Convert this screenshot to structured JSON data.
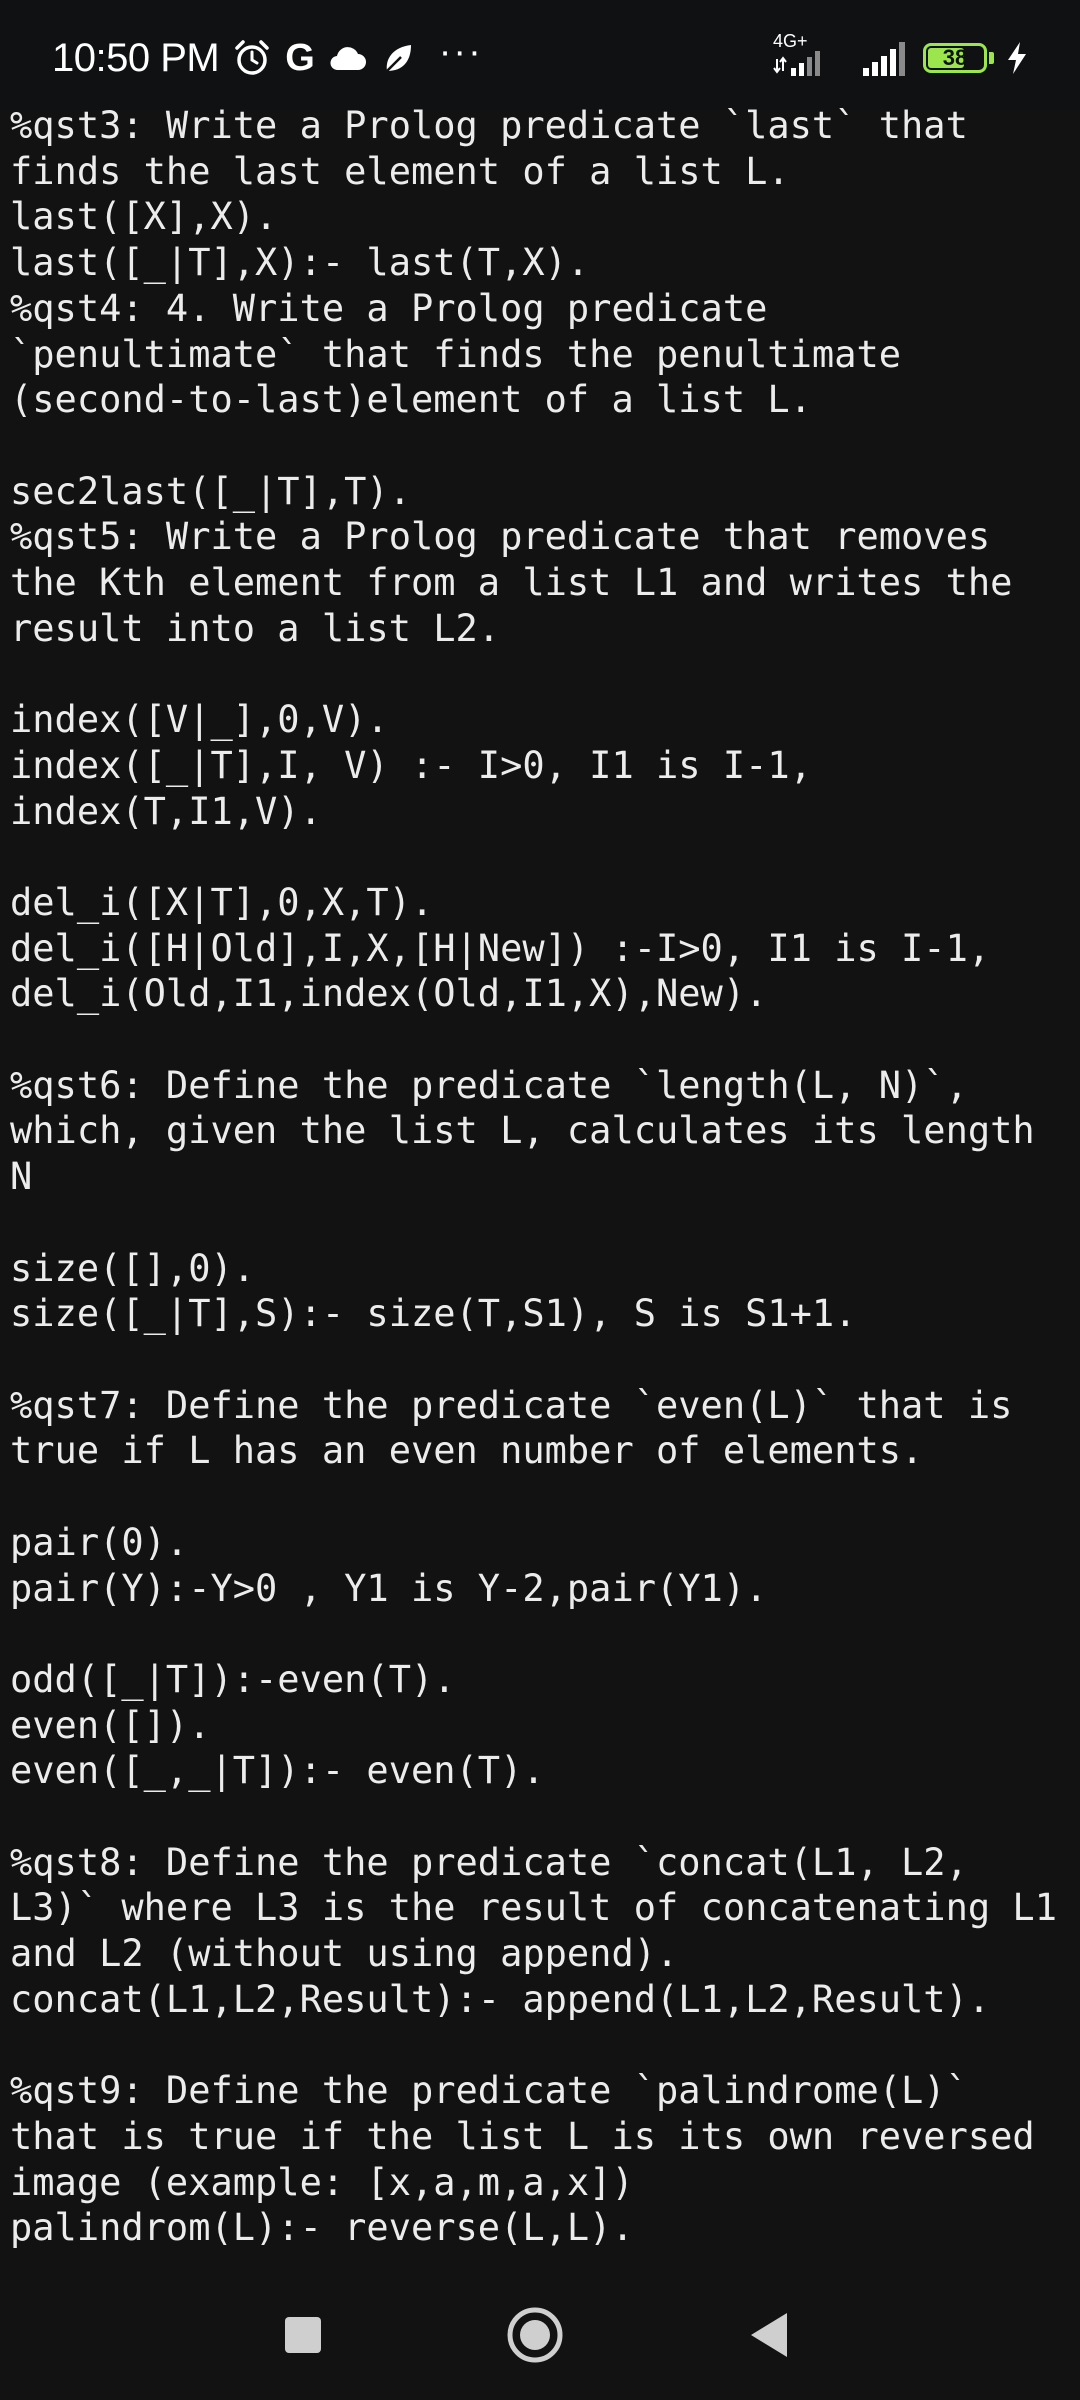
{
  "status_bar": {
    "time": "10:50 PM",
    "icons_left": [
      "alarm-icon",
      "google-icon",
      "cloud-icon",
      "app-notification-icon"
    ],
    "google_letter": "G",
    "overflow": "···",
    "network_label": "4G+",
    "battery_level": "38",
    "battery_fraction": 0.38,
    "battery_color": "#9be64d",
    "charging": true
  },
  "document": {
    "text": "%qst3: Write a Prolog predicate `last` that finds the last element of a list L.\nlast([X],X).\nlast([_|T],X):- last(T,X).\n%qst4: 4. Write a Prolog predicate `penultimate` that finds the penultimate (second-to-last)element of a list L.\n\nsec2last([_|T],T).\n%qst5: Write a Prolog predicate that removes the Kth element from a list L1 and writes the result into a list L2.\n\nindex([V|_],0,V).\nindex([_|T],I, V) :- I>0, I1 is I-1, index(T,I1,V).\n\ndel_i([X|T],0,X,T).\ndel_i([H|Old],I,X,[H|New]) :-I>0, I1 is I-1, del_i(Old,I1,index(Old,I1,X),New).\n\n%qst6: Define the predicate `length(L, N)`, which, given the list L, calculates its length N\n\nsize([],0).\nsize([_|T],S):- size(T,S1), S is S1+1.\n\n%qst7: Define the predicate `even(L)` that is true if L has an even number of elements.\n\npair(0).\npair(Y):-Y>0 , Y1 is Y-2,pair(Y1).\n\nodd([_|T]):-even(T).\neven([]).\neven([_,_|T]):- even(T).\n\n%qst8: Define the predicate `concat(L1, L2, L3)` where L3 is the result of concatenating L1 and L2 (without using append).\nconcat(L1,L2,Result):- append(L1,L2,Result).\n\n%qst9: Define the predicate `palindrome(L)` that is true if the list L is its own reversed image (example: [x,a,m,a,x])\npalindrom(L):- reverse(L,L)."
  },
  "nav_bar": {
    "buttons": [
      "recents-button",
      "home-button",
      "back-button"
    ]
  }
}
